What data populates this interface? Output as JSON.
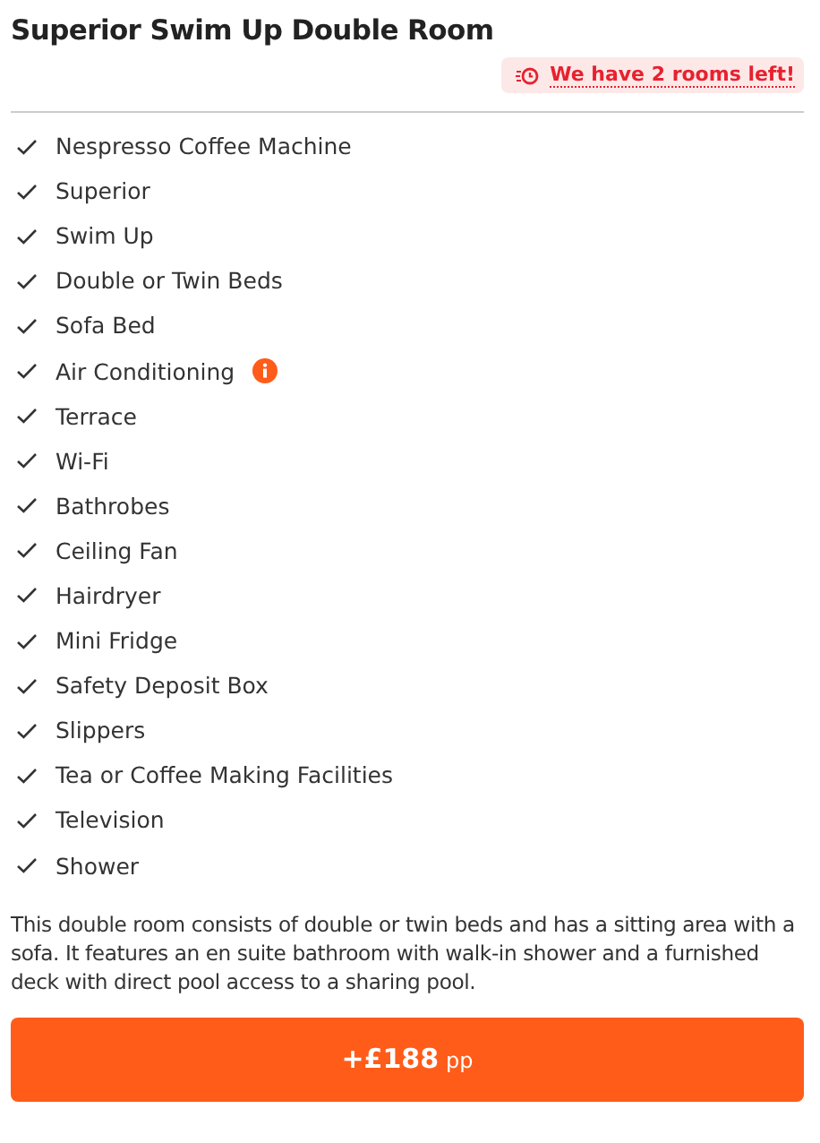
{
  "room": {
    "title": "Superior Swim Up Double Room",
    "availability": "We have 2 rooms left!"
  },
  "amenities": [
    {
      "label": "Nespresso Coffee Machine",
      "info": false
    },
    {
      "label": "Superior",
      "info": false
    },
    {
      "label": "Swim Up",
      "info": false
    },
    {
      "label": "Double or Twin Beds",
      "info": false
    },
    {
      "label": "Sofa Bed",
      "info": false
    },
    {
      "label": "Air Conditioning",
      "info": true
    },
    {
      "label": "Terrace",
      "info": false
    },
    {
      "label": "Wi-Fi",
      "info": false
    },
    {
      "label": "Bathrobes",
      "info": false
    },
    {
      "label": "Ceiling Fan",
      "info": false
    },
    {
      "label": "Hairdryer",
      "info": false
    },
    {
      "label": "Mini Fridge",
      "info": false
    },
    {
      "label": "Safety Deposit Box",
      "info": false
    },
    {
      "label": "Slippers",
      "info": false
    },
    {
      "label": "Tea or Coffee Making Facilities",
      "info": false
    },
    {
      "label": "Television",
      "info": false
    },
    {
      "label": "Shower",
      "info": false
    }
  ],
  "description": "This double room consists of double or twin beds and has a sitting area with a sofa. It features an en suite bathroom with walk-in shower and a furnished deck with direct pool access to a sharing pool.",
  "price_button": {
    "price": "+£188",
    "unit": "pp"
  }
}
